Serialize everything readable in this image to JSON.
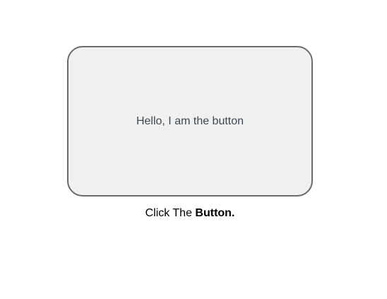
{
  "button": {
    "label": "Hello, I am the button"
  },
  "caption": {
    "prefix": "Click The ",
    "emphasis": "Button."
  },
  "colors": {
    "button_bg": "#f0f0f0",
    "button_border": "#6b6b6b",
    "button_text": "#3d4a55"
  }
}
